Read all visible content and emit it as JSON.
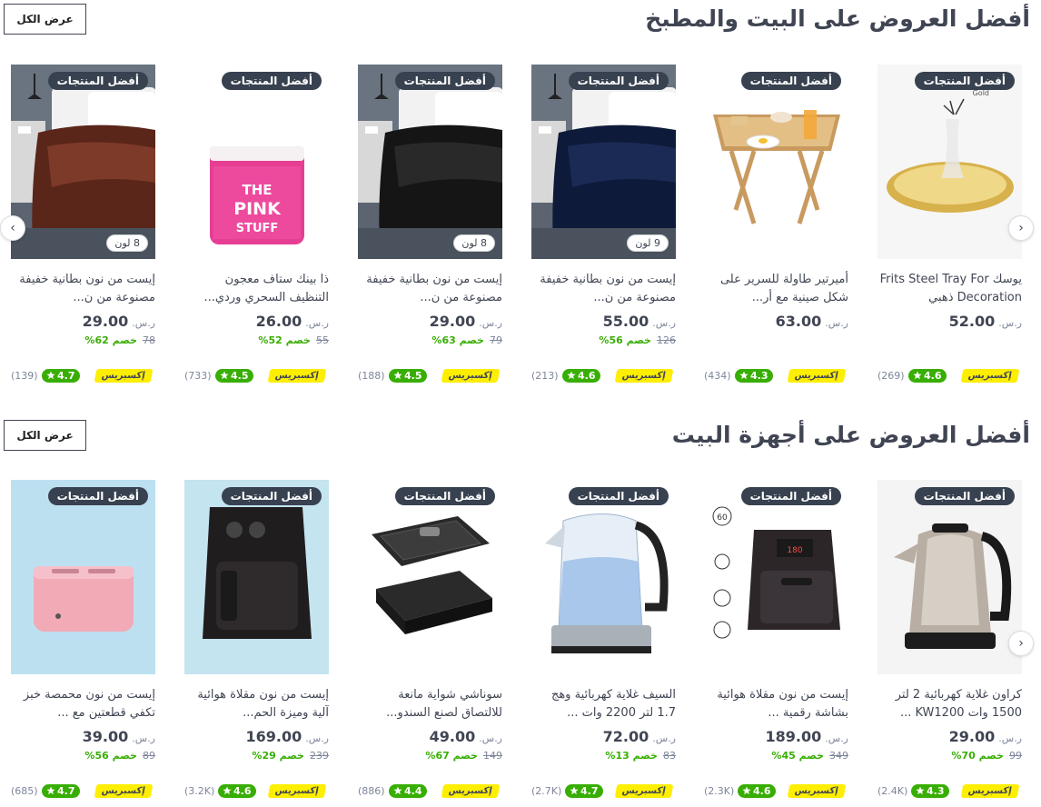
{
  "sections": [
    {
      "title": "أفضل العروض على البيت والمطبخ",
      "view_all": "عرض الكل",
      "products": [
        {
          "badge": "أفضل المنتجات",
          "colors": "",
          "name": "يوسك Frits Steel Tray For Decoration ذهبي",
          "currency": "ر.س.",
          "price": "52.00",
          "old": "",
          "discount": "",
          "express": "إكسبريس",
          "rating": "4.6",
          "count": "(269)",
          "img": "tray",
          "img_text": "Gold"
        },
        {
          "badge": "أفضل المنتجات",
          "colors": "",
          "name": "أميرتير طاولة للسرير على شكل صينية مع أر...",
          "currency": "ر.س.",
          "price": "63.00",
          "old": "",
          "discount": "",
          "express": "إكسبريس",
          "rating": "4.3",
          "count": "(434)",
          "img": "bedtable",
          "img_text": ""
        },
        {
          "badge": "أفضل المنتجات",
          "colors": "9 لون",
          "name": "إيست من نون بطانية خفيفة مصنوعة من ن...",
          "currency": "ر.س.",
          "price": "55.00",
          "old": "126",
          "discount": "خصم 56%",
          "express": "إكسبريس",
          "rating": "4.6",
          "count": "(213)",
          "img": "blanket-navy",
          "img_text": ""
        },
        {
          "badge": "أفضل المنتجات",
          "colors": "8 لون",
          "name": "إيست من نون بطانية خفيفة مصنوعة من ن...",
          "currency": "ر.س.",
          "price": "29.00",
          "old": "79",
          "discount": "خصم 63%",
          "express": "إكسبريس",
          "rating": "4.5",
          "count": "(188)",
          "img": "blanket-black",
          "img_text": ""
        },
        {
          "badge": "أفضل المنتجات",
          "colors": "",
          "name": "ذا بينك ستاف معجون التنظيف السحري وردي...",
          "currency": "ر.س.",
          "price": "26.00",
          "old": "55",
          "discount": "خصم 52%",
          "express": "إكسبريس",
          "rating": "4.5",
          "count": "(733)",
          "img": "pink",
          "img_text": "THE PINK STUFF"
        },
        {
          "badge": "أفضل المنتجات",
          "colors": "8 لون",
          "name": "إيست من نون بطانية خفيفة مصنوعة من ن...",
          "currency": "ر.س.",
          "price": "29.00",
          "old": "78",
          "discount": "خصم 62%",
          "express": "إكسبريس",
          "rating": "4.7",
          "count": "(139)",
          "img": "blanket-brown",
          "img_text": ""
        }
      ]
    },
    {
      "title": "أفضل العروض على أجهزة البيت",
      "view_all": "عرض الكل",
      "products": [
        {
          "badge": "أفضل المنتجات",
          "colors": "",
          "name": "كراون غلاية كهربائية 2 لتر 1500 وات KW1200 ...",
          "currency": "ر.س.",
          "price": "29.00",
          "old": "99",
          "discount": "خصم 70%",
          "express": "إكسبريس",
          "rating": "4.3",
          "count": "(2.4K)",
          "img": "kettle-steel",
          "img_text": ""
        },
        {
          "badge": "أفضل المنتجات",
          "colors": "",
          "name": "إيست من نون مقلاة هوائية بشاشة رقمية ...",
          "currency": "ر.س.",
          "price": "189.00",
          "old": "349",
          "discount": "خصم 45%",
          "express": "إكسبريس",
          "rating": "4.6",
          "count": "(2.3K)",
          "img": "airfryer-digital",
          "img_text": "180"
        },
        {
          "badge": "أفضل المنتجات",
          "colors": "",
          "name": "السيف غلاية كهربائية وهج 1.7 لتر 2200 وات ...",
          "currency": "ر.س.",
          "price": "72.00",
          "old": "83",
          "discount": "خصم 13%",
          "express": "إكسبريس",
          "rating": "4.7",
          "count": "(2.7K)",
          "img": "kettle-glass",
          "img_text": ""
        },
        {
          "badge": "أفضل المنتجات",
          "colors": "",
          "name": "سوناشي شواية مانعة للالتصاق لصنع السندو...",
          "currency": "ر.س.",
          "price": "49.00",
          "old": "149",
          "discount": "خصم 67%",
          "express": "إكسبريس",
          "rating": "4.4",
          "count": "(886)",
          "img": "sandwich",
          "img_text": ""
        },
        {
          "badge": "أفضل المنتجات",
          "colors": "",
          "name": "إيست من نون مقلاة هوائية آلية وميزة الحم...",
          "currency": "ر.س.",
          "price": "169.00",
          "old": "239",
          "discount": "خصم 29%",
          "express": "إكسبريس",
          "rating": "4.6",
          "count": "(3.2K)",
          "img": "airfryer-knob",
          "img_text": ""
        },
        {
          "badge": "أفضل المنتجات",
          "colors": "",
          "name": "إيست من نون محمصة خبز تكفي قطعتين مع ...",
          "currency": "ر.س.",
          "price": "39.00",
          "old": "89",
          "discount": "خصم 56%",
          "express": "إكسبريس",
          "rating": "4.7",
          "count": "(685)",
          "img": "toaster",
          "img_text": ""
        }
      ]
    }
  ],
  "colors": {
    "accent_yellow": "#feee00",
    "rating_green": "#38ae04",
    "badge_dark": "#384150",
    "text": "#404553"
  },
  "icons": {
    "star": "star-icon",
    "next": "chevron-right-icon",
    "prev": "chevron-left-icon"
  }
}
